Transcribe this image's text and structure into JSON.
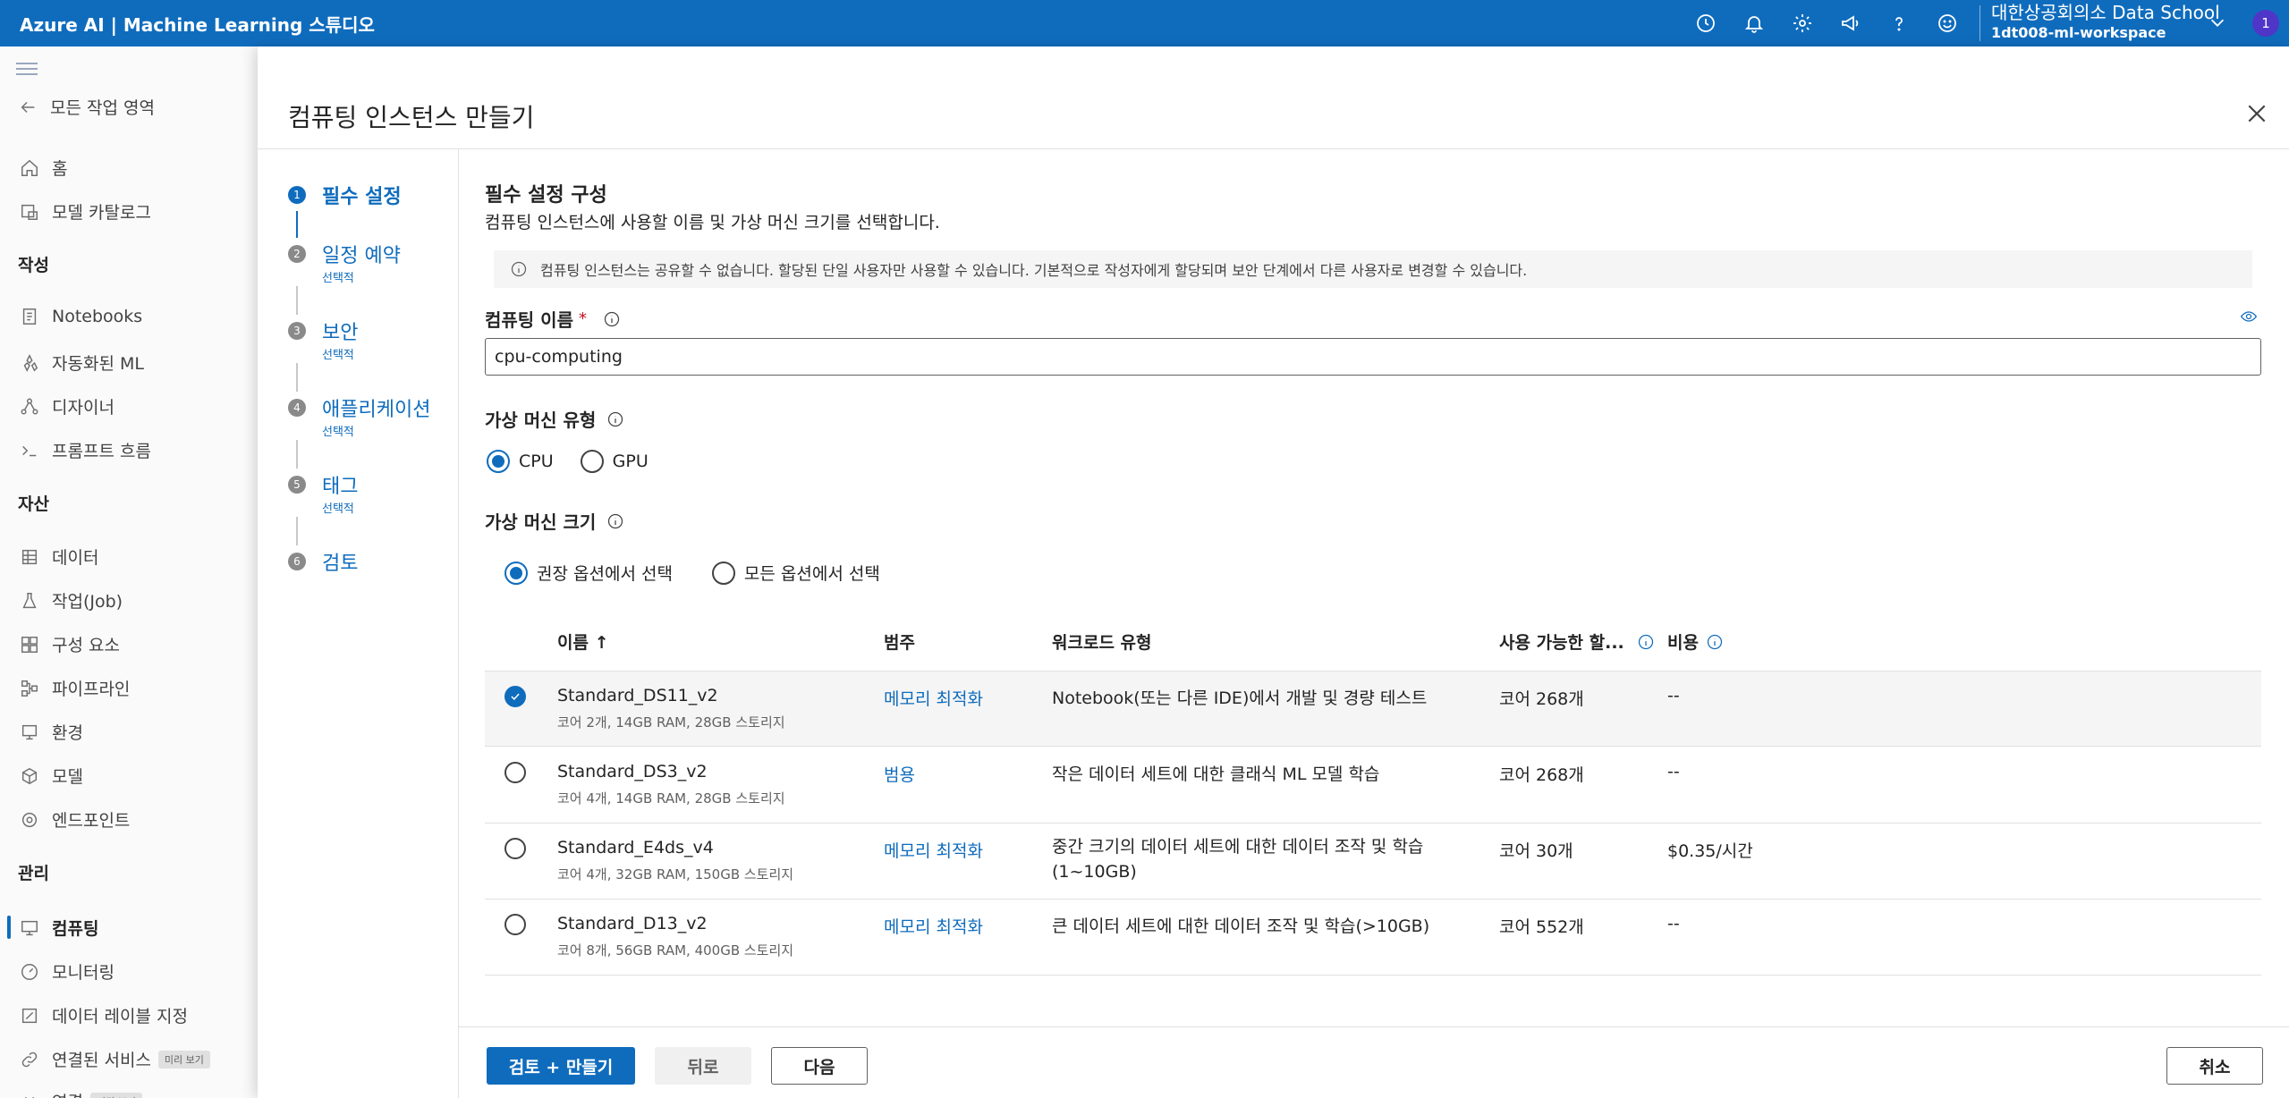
{
  "app": {
    "title": "Azure AI | Machine Learning 스튜디오"
  },
  "header": {
    "org_name": "대한상공회의소 Data School",
    "workspace_name": "1dt008-ml-workspace",
    "avatar_initial": "1",
    "icons": [
      "history-icon",
      "bell-icon",
      "gear-icon",
      "megaphone-icon",
      "help-icon",
      "smiley-icon"
    ]
  },
  "nav": {
    "back_label": "모든 작업 영역",
    "home": "홈",
    "model_catalog": "모델 카탈로그",
    "section_authoring": "작성",
    "notebooks": "Notebooks",
    "automl": "자동화된 ML",
    "designer": "디자이너",
    "prompt_flow": "프롬프트 흐름",
    "section_assets": "자산",
    "data": "데이터",
    "jobs": "작업(Job)",
    "components": "구성 요소",
    "pipelines": "파이프라인",
    "environments": "환경",
    "models": "모델",
    "endpoints": "엔드포인트",
    "section_manage": "관리",
    "compute": "컴퓨팅",
    "monitoring": "모니터링",
    "data_labeling": "데이터 레이블 지정",
    "linked_services": "연결된 서비스",
    "preview_badge": "미리 보기",
    "connections": "연결"
  },
  "panel": {
    "title": "컴퓨팅 인스턴스 만들기",
    "steps": [
      {
        "num": "1",
        "label": "필수 설정",
        "sub": ""
      },
      {
        "num": "2",
        "label": "일정 예약",
        "sub": "선택적"
      },
      {
        "num": "3",
        "label": "보안",
        "sub": "선택적"
      },
      {
        "num": "4",
        "label": "애플리케이션",
        "sub": "선택적"
      },
      {
        "num": "5",
        "label": "태그",
        "sub": "선택적"
      },
      {
        "num": "6",
        "label": "검토",
        "sub": ""
      }
    ]
  },
  "form": {
    "section_title": "필수 설정 구성",
    "section_desc": "컴퓨팅 인스턴스에 사용할 이름 및 가상 머신 크기를 선택합니다.",
    "info_message": "컴퓨팅 인스턴스는 공유할 수 없습니다. 할당된 단일 사용자만 사용할 수 있습니다. 기본적으로 작성자에게 할당되며 보안 단계에서 다른 사용자로 변경할 수 있습니다.",
    "name_label": "컴퓨팅 이름",
    "required_mark": "*",
    "name_value": "cpu-computing",
    "vm_type_label": "가상 머신 유형",
    "vm_type_cpu": "CPU",
    "vm_type_gpu": "GPU",
    "vm_size_label": "가상 머신 크기",
    "size_opt_recommended": "권장 옵션에서 선택",
    "size_opt_all": "모든 옵션에서 선택"
  },
  "table": {
    "headers": {
      "name": "이름 ↑",
      "category": "범주",
      "workload": "워크로드 유형",
      "available": "사용 가능한 할...",
      "cost": "비용"
    },
    "rows": [
      {
        "name": "Standard_DS11_v2",
        "spec": "코어 2개, 14GB RAM, 28GB 스토리지",
        "category": "메모리 최적화",
        "workload": "Notebook(또는 다른 IDE)에서 개발 및 경량 테스트",
        "available": "코어 268개",
        "cost": "--"
      },
      {
        "name": "Standard_DS3_v2",
        "spec": "코어 4개, 14GB RAM, 28GB 스토리지",
        "category": "범용",
        "workload": "작은 데이터 세트에 대한 클래식 ML 모델 학습",
        "available": "코어 268개",
        "cost": "--"
      },
      {
        "name": "Standard_E4ds_v4",
        "spec": "코어 4개, 32GB RAM, 150GB 스토리지",
        "category": "메모리 최적화",
        "workload": "중간 크기의 데이터 세트에 대한 데이터 조작 및 학습 (1~10GB)",
        "available": "코어 30개",
        "cost": "$0.35/시간"
      },
      {
        "name": "Standard_D13_v2",
        "spec": "코어 8개, 56GB RAM, 400GB 스토리지",
        "category": "메모리 최적화",
        "workload": "큰 데이터 세트에 대한 데이터 조작 및 학습(>10GB)",
        "available": "코어 552개",
        "cost": "--"
      }
    ]
  },
  "footer": {
    "review_create": "검토 + 만들기",
    "back": "뒤로",
    "next": "다음",
    "cancel": "취소"
  }
}
